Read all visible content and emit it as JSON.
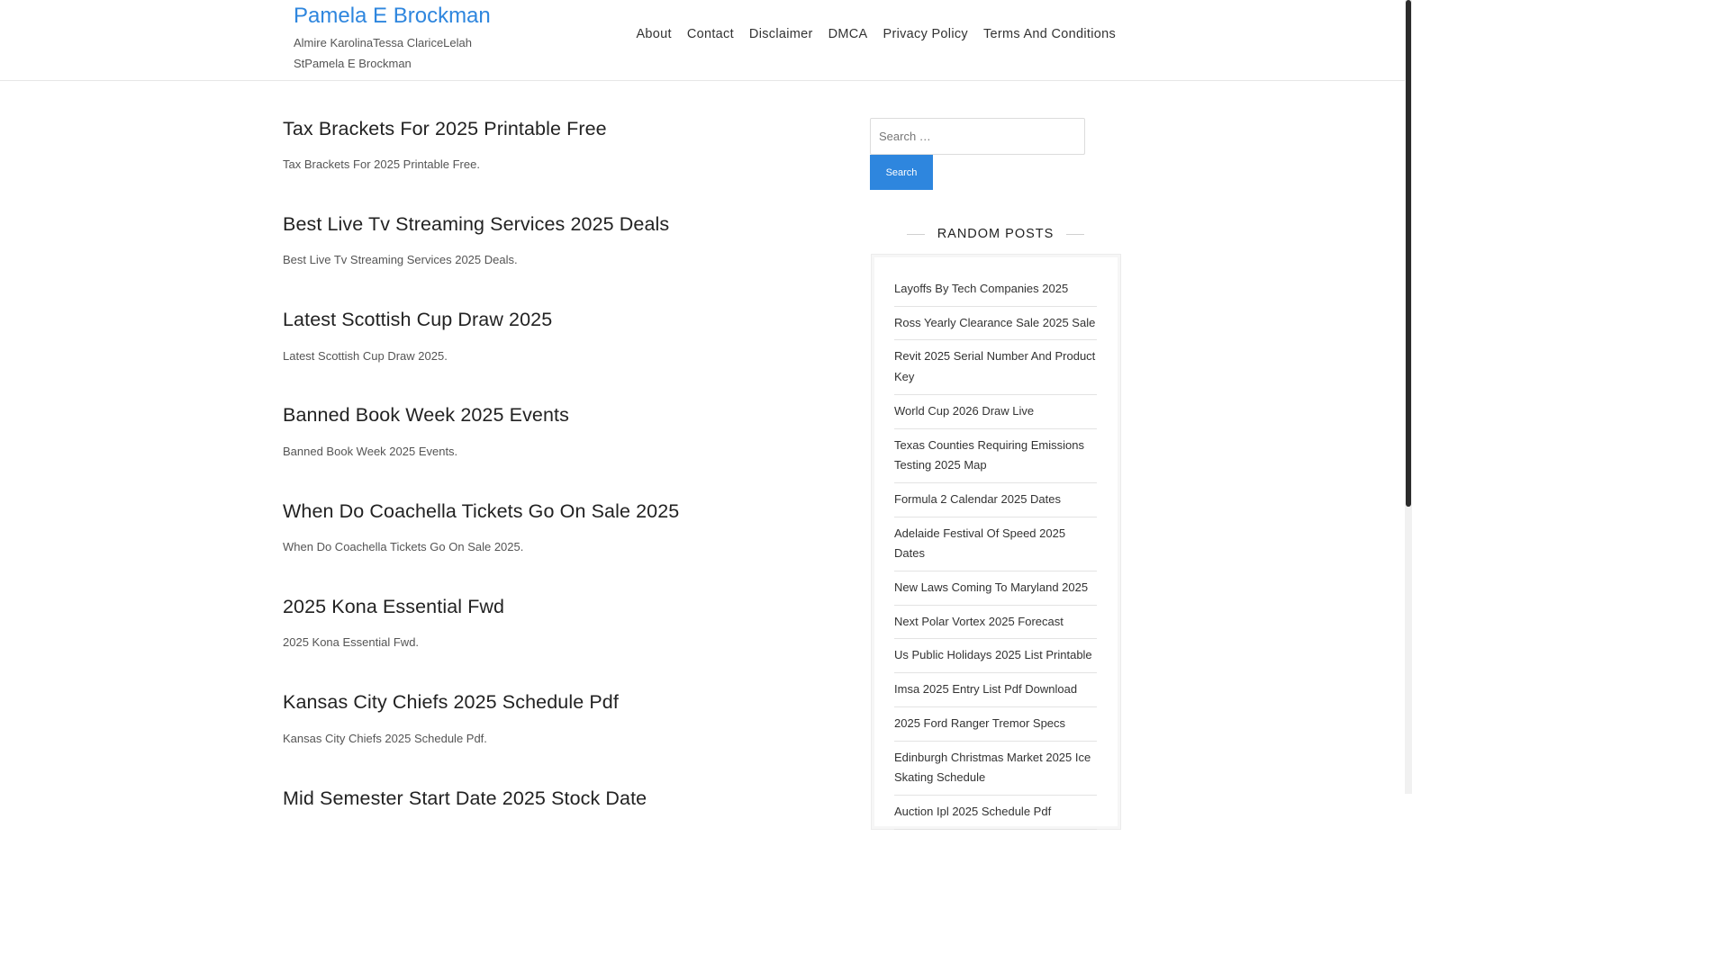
{
  "header": {
    "site_title": "Pamela E Brockman",
    "site_description": "Almire KarolinaTessa ClariceLelah StPamela E Brockman",
    "nav": [
      "About",
      "Contact",
      "Disclaimer",
      "DMCA",
      "Privacy Policy",
      "Terms And Conditions"
    ]
  },
  "posts": [
    {
      "title": "Tax Brackets For 2025 Printable Free",
      "excerpt": "Tax Brackets For 2025 Printable Free."
    },
    {
      "title": "Best Live Tv Streaming Services 2025 Deals",
      "excerpt": "Best Live Tv Streaming Services 2025 Deals."
    },
    {
      "title": "Latest Scottish Cup Draw 2025",
      "excerpt": "Latest Scottish Cup Draw 2025."
    },
    {
      "title": "Banned Book Week 2025 Events",
      "excerpt": "Banned Book Week 2025 Events."
    },
    {
      "title": "When Do Coachella Tickets Go On Sale 2025",
      "excerpt": "When Do Coachella Tickets Go On Sale 2025."
    },
    {
      "title": "2025 Kona Essential Fwd",
      "excerpt": "2025 Kona Essential Fwd."
    },
    {
      "title": "Kansas City Chiefs 2025 Schedule Pdf",
      "excerpt": "Kansas City Chiefs 2025 Schedule Pdf."
    },
    {
      "title": "Mid Semester Start Date 2025 Stock Date",
      "excerpt": ""
    }
  ],
  "sidebar": {
    "search_placeholder": "Search …",
    "search_button": "Search",
    "random_posts_heading": "RANDOM POSTS",
    "random_posts": [
      "Layoffs By Tech Companies 2025",
      "Ross Yearly Clearance Sale 2025 Sale",
      "Revit 2025 Serial Number And Product Key",
      "World Cup 2026 Draw Live",
      "Texas Counties Requiring Emissions Testing 2025 Map",
      "Formula 2 Calendar 2025 Dates",
      "Adelaide Festival Of Speed 2025 Dates",
      "New Laws Coming To Maryland 2025",
      "Next Polar Vortex 2025 Forecast",
      "Us Public Holidays 2025 List Printable",
      "Imsa 2025 Entry List Pdf Download",
      "2025 Ford Ranger Tremor Specs",
      "Edinburgh Christmas Market 2025 Ice Skating Schedule",
      "Auction Ipl 2025 Schedule Pdf"
    ]
  },
  "colors": {
    "accent": "#2e86de",
    "text": "#333333",
    "scrollbar_thumb": "#2b2b2b"
  }
}
